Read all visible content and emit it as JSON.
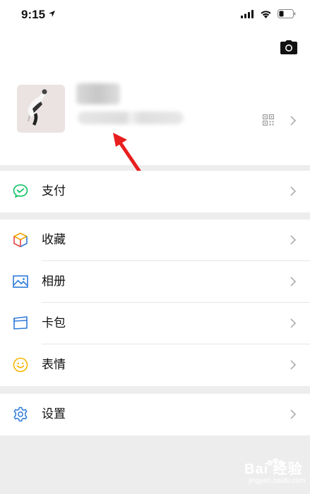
{
  "status_bar": {
    "time": "9:15"
  },
  "menu": {
    "pay": {
      "label": "支付",
      "icon": "wechat-pay-icon",
      "color": "#07c160"
    },
    "favorites": {
      "label": "收藏",
      "icon": "favorites-cube-icon"
    },
    "album": {
      "label": "相册",
      "icon": "album-image-icon",
      "color": "#2f7bd9"
    },
    "cards": {
      "label": "卡包",
      "icon": "card-wallet-icon",
      "color": "#2f7bd9"
    },
    "sticker": {
      "label": "表情",
      "icon": "smiley-icon",
      "color": "#f5b700"
    },
    "settings": {
      "label": "设置",
      "icon": "settings-gear-icon",
      "color": "#2f7bd9"
    }
  },
  "watermark": {
    "text": "Bai 经验",
    "sub": "jingyan.baidu.com"
  },
  "colors": {
    "background": "#ededed",
    "annotation": "#e81e1e"
  }
}
